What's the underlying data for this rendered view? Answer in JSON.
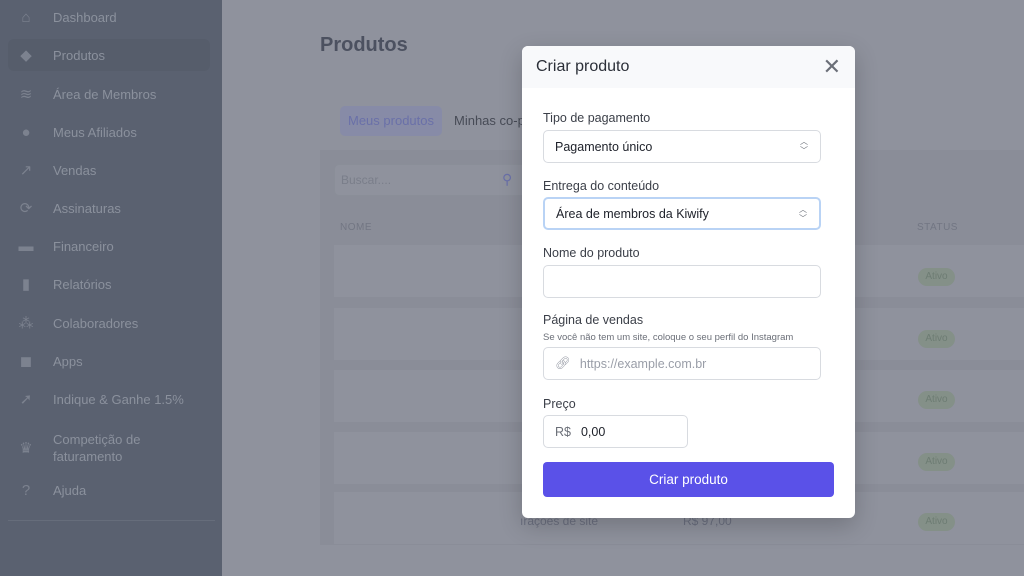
{
  "sidebar": {
    "items": [
      {
        "label": "Dashboard",
        "icon": "home-icon",
        "glyph": "⌂"
      },
      {
        "label": "Produtos",
        "icon": "tag-icon",
        "glyph": "◆",
        "active": true
      },
      {
        "label": "Área de Membros",
        "icon": "graduation-cap-icon",
        "glyph": "≋"
      },
      {
        "label": "Meus Afiliados",
        "icon": "user-icon",
        "glyph": "●"
      },
      {
        "label": "Vendas",
        "icon": "trending-up-icon",
        "glyph": "↗"
      },
      {
        "label": "Assinaturas",
        "icon": "refresh-icon",
        "glyph": "⟳"
      },
      {
        "label": "Financeiro",
        "icon": "credit-card-icon",
        "glyph": "▬"
      },
      {
        "label": "Relatórios",
        "icon": "bar-chart-icon",
        "glyph": "▮"
      },
      {
        "label": "Colaboradores",
        "icon": "users-icon",
        "glyph": "⁂"
      },
      {
        "label": "Apps",
        "icon": "cube-icon",
        "glyph": "◼"
      },
      {
        "label": "Indique & Ganhe 1.5%",
        "icon": "cursor-click-icon",
        "glyph": "➚"
      },
      {
        "label": "Competição de faturamento",
        "icon": "trophy-icon",
        "glyph": "♛"
      },
      {
        "label": "Ajuda",
        "icon": "help-circle-icon",
        "glyph": "?"
      }
    ]
  },
  "page": {
    "title": "Produtos",
    "tabs": [
      "Meus produtos",
      "Minhas co-p"
    ],
    "search_placeholder": "Buscar....",
    "columns": [
      "NOME",
      "STATUS"
    ],
    "status": [
      "Ativo",
      "Ativo",
      "Ativo",
      "Ativo",
      "Ativo"
    ],
    "row_fragment": "ırações de site",
    "row_price": "R$ 97,00"
  },
  "modal": {
    "title": "Criar produto",
    "payment_label": "Tipo de pagamento",
    "payment_value": "Pagamento único",
    "delivery_label": "Entrega do conteúdo",
    "delivery_value": "Área de membros da Kiwify",
    "name_label": "Nome do produto",
    "name_value": "",
    "sales_label": "Página de vendas",
    "sales_hint": "Se você não tem um site, coloque o seu perfil do Instagram",
    "sales_placeholder": "https://example.com.br",
    "price_label": "Preço",
    "price_prefix": "R$",
    "price_value": "0,00",
    "submit": "Criar produto"
  },
  "colors": {
    "accent": "#5a51e8"
  }
}
